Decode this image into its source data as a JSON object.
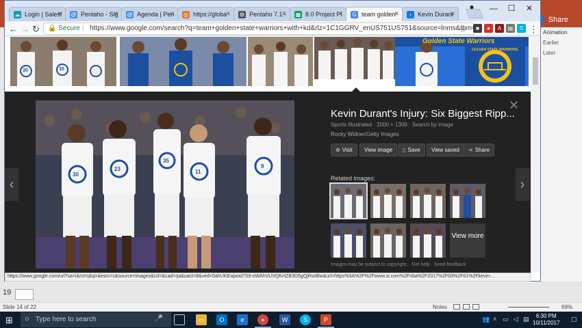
{
  "powerpoint": {
    "share_label": "Share",
    "pane_title": "Animation",
    "pane_items": [
      "Earlier",
      "Later"
    ],
    "slide_number": "19",
    "status": {
      "slide_label": "Slide 14 of 22",
      "notes_label": "Notes",
      "zoom": "69%"
    }
  },
  "chrome": {
    "tabs": [
      {
        "label": "Login | Salesf",
        "color": "#1798c1",
        "glyph": "☁"
      },
      {
        "label": "Pentaho - Sig",
        "color": "#4a90d9",
        "glyph": "@"
      },
      {
        "label": "Agenda | Pen",
        "color": "#4a90d9",
        "glyph": "@"
      },
      {
        "label": "https://globa",
        "color": "#d97c2b",
        "glyph": "◎"
      },
      {
        "label": "Pentaho 7.1 -",
        "color": "#555555",
        "glyph": "⚙"
      },
      {
        "label": "8.0 Project Pl",
        "color": "#0f9d58",
        "glyph": "▦"
      },
      {
        "label": "team golden",
        "color": "#4285f4",
        "glyph": "G"
      },
      {
        "label": "Kevin Durant",
        "color": "#1a73e8",
        "glyph": "›"
      }
    ],
    "secure_label": "Secure",
    "url": "https://www.google.com/search?q=team+golden+state+warriors+with+kd&rlz=1C1GGRV_enUS751US751&source=lnms&tbm=isch&sa=X...",
    "status_url": "https://www.google.com/url?sa=i&rct=j&q=&esrc=s&source=images&cd=&cad=rja&uact=8&ved=0ahUKEwjxod7S9-nWAhVLhIQKHZB3D5gQjRwIBw&url=https%3A%2F%2Fwww.si.com%2Fnba%2F2017%2F03%2F01%2Fkevin-..."
  },
  "viewer": {
    "title": "Kevin Durant's Injury: Six Biggest Ripp...",
    "source_line": "Sports Illustrated  ·  2000 × 1300  ·  Search by image",
    "credit": "Rocky Widner/Getty Images",
    "buttons": [
      "Visit",
      "View image",
      "Save",
      "View saved",
      "Share"
    ],
    "related_label": "Related images:",
    "view_more": "View more",
    "disclaimer": "Images may be subject to copyright.  ·  Get help  ·  Send feedback"
  },
  "strip_banner_text": "Golden State Warriors",
  "strip_logo_text": "GOLDEN STATE WARRIORS",
  "player_numbers": [
    "30",
    "35",
    "23",
    "11",
    "9"
  ],
  "taskbar": {
    "search_placeholder": "Type here to search",
    "time": "6:30 PM",
    "date": "10/11/2017"
  },
  "colors": {
    "ppt_accent": "#b7472a",
    "viewer_bg": "#222222",
    "warriors_blue": "#1d4fa0",
    "warriors_gold": "#f3c315"
  }
}
